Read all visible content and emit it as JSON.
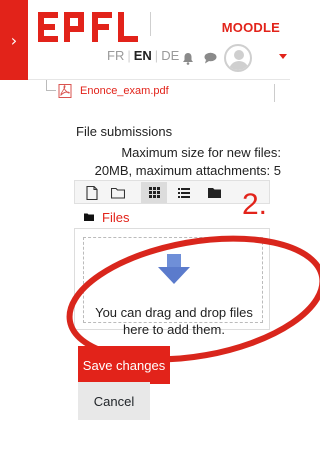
{
  "header": {
    "drawer_toggle_glyph": "›",
    "brand": "EPFL",
    "moodle_label": "MOODLE",
    "languages": [
      {
        "code": "FR",
        "active": false
      },
      {
        "code": "EN",
        "active": true
      },
      {
        "code": "DE",
        "active": false
      }
    ],
    "icons": [
      "bell-icon",
      "chat-icon",
      "avatar",
      "chevron-down-icon"
    ]
  },
  "attachment": {
    "file_name": "Enonce_exam.pdf"
  },
  "submission": {
    "section_label": "File submissions",
    "max_size_line1": "Maximum size for new files:",
    "max_size_line2": "20MB, maximum attachments: 5"
  },
  "filepicker": {
    "toolbar_icons": [
      "add-file-icon",
      "create-folder-icon",
      "grid-view-icon",
      "list-view-icon",
      "tree-view-icon"
    ],
    "breadcrumb_label": "Files",
    "dropzone_line1": "You can drag and drop files",
    "dropzone_line2": "here to add them."
  },
  "annotation": {
    "number": "2.",
    "color": "#e2231a"
  },
  "actions": {
    "save_label": "Save changes",
    "cancel_label": "Cancel"
  },
  "colors": {
    "accent": "#e2231a",
    "dropzone_arrow": "#6f8fd8"
  }
}
